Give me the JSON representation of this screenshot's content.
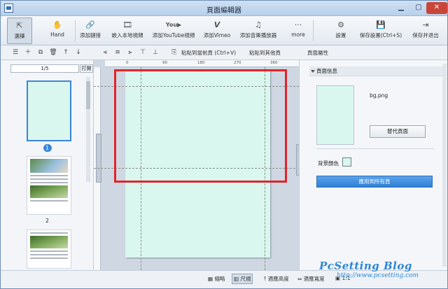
{
  "window": {
    "title": "頁面編輯器"
  },
  "toolbar": {
    "items": [
      {
        "label": "選擇",
        "icon": "cursor-icon"
      },
      {
        "label": "Hand",
        "icon": "hand-icon"
      },
      {
        "label": "添加鏈接",
        "icon": "link-icon"
      },
      {
        "label": "嵌入本地視頻",
        "icon": "film-icon"
      },
      {
        "label": "添加YouTube視頻",
        "icon": "youtube-icon"
      },
      {
        "label": "添加Vimeo",
        "icon": "vimeo-icon"
      },
      {
        "label": "添加音樂播放器",
        "icon": "music-icon"
      },
      {
        "label": "more",
        "icon": "more-icon"
      },
      {
        "label": "設置",
        "icon": "gear-icon"
      },
      {
        "label": "保存設置(Ctrl+S)",
        "icon": "save-icon"
      },
      {
        "label": "保存并退出",
        "icon": "exit-icon"
      }
    ]
  },
  "subbar": {
    "paste_prev": "粘貼到當前頁 (Ctrl+V)",
    "paste_other": "粘貼到其他頁",
    "panel_title": "頁面屬性"
  },
  "pages": {
    "indicator": "1/5",
    "open_label": "打開",
    "thumbs": [
      {
        "label": "1"
      },
      {
        "label": "2"
      }
    ]
  },
  "ruler": {
    "ticks": [
      "0",
      "90",
      "180",
      "270",
      "360"
    ]
  },
  "properties": {
    "section": "頁面信息",
    "bg_file": "bg.png",
    "replace_label": "替代頁面",
    "bg_color_label": "背景顏色",
    "bg_color": "#d9f7ee",
    "apply_label": "應用到所有頁"
  },
  "status": {
    "thumb": "縮略",
    "ruler": "尺規",
    "fit_height": "適應高度",
    "fit_width": "適應寬度",
    "ratio": "1:1"
  },
  "watermark": {
    "brand": "PcSetting Blog",
    "url": "http://www.pcsetting.com"
  }
}
